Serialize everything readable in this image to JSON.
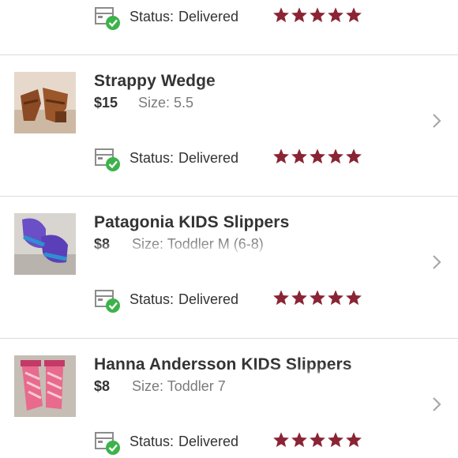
{
  "colors": {
    "star": "#8a2434",
    "check": "#3cb34a",
    "chevron": "#a8a8a8",
    "divider": "#dcdcdc"
  },
  "top_row": {
    "status_label": "Status:",
    "status_value": "Delivered",
    "rating": 5
  },
  "items": [
    {
      "title": "Strappy Wedge",
      "price": "$15",
      "size": "Size: 5.5",
      "thumb_icon": "brown-wedge-shoe-image",
      "status_label": "Status:",
      "status_value": "Delivered",
      "rating": 5
    },
    {
      "title": "Patagonia KIDS Slippers",
      "price": "$8",
      "size": "Size: Toddler M (6-8)",
      "thumb_icon": "purple-slippers-image",
      "status_label": "Status:",
      "status_value": "Delivered",
      "rating": 5
    },
    {
      "title": "Hanna Andersson KIDS Slippers",
      "price": "$8",
      "size": "Size: Toddler 7",
      "thumb_icon": "pink-slippers-image",
      "status_label": "Status:",
      "status_value": "Delivered",
      "rating": 5
    }
  ]
}
